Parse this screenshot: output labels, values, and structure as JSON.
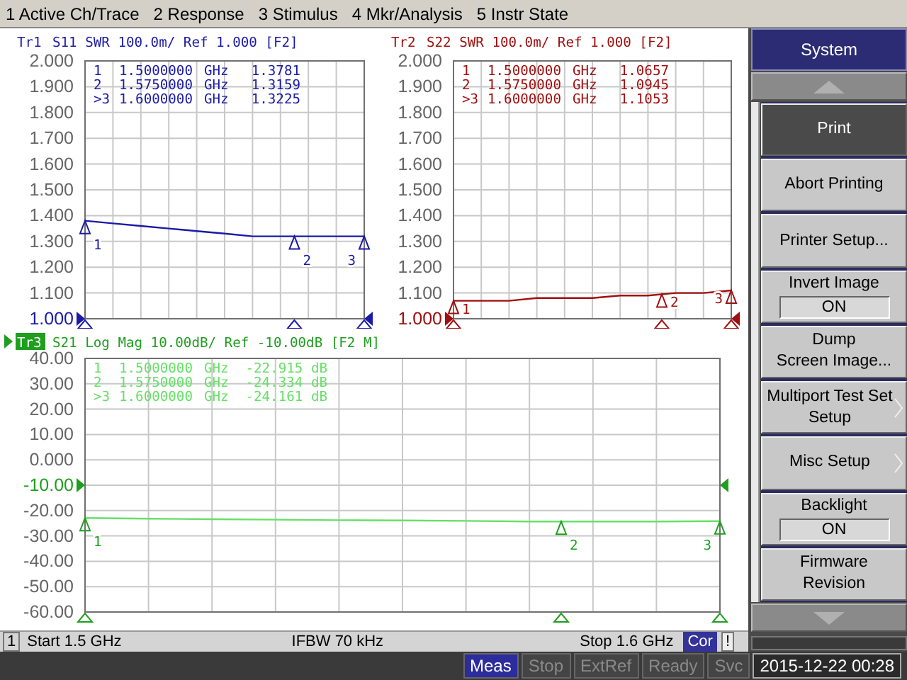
{
  "menu": [
    "1 Active Ch/Trace",
    "2 Response",
    "3 Stimulus",
    "4 Mkr/Analysis",
    "5 Instr State"
  ],
  "traces": [
    {
      "trace": "Tr1",
      "active": false,
      "header": "S11 SWR 100.0m/ Ref 1.000 [F2]",
      "markers": [
        {
          "number": "1",
          "frequency": "1.5000000",
          "unit": "GHz",
          "value": "1.3781",
          "label": "1"
        },
        {
          "number": "2",
          "frequency": "1.5750000",
          "unit": "GHz",
          "value": "1.3159",
          "label": "2"
        },
        {
          "number": ">3",
          "frequency": "1.6000000",
          "unit": "GHz",
          "value": "1.3225",
          "label": "3"
        }
      ],
      "chart_data": {
        "type": "line",
        "ylim": [
          1.0,
          2.0
        ],
        "yticks": [
          {
            "value": 2.0,
            "label": "2.000"
          },
          {
            "value": 1.9,
            "label": "1.900"
          },
          {
            "value": 1.8,
            "label": "1.800"
          },
          {
            "value": 1.7,
            "label": "1.700"
          },
          {
            "value": 1.6,
            "label": "1.600"
          },
          {
            "value": 1.5,
            "label": "1.500"
          },
          {
            "value": 1.4,
            "label": "1.400"
          },
          {
            "value": 1.3,
            "label": "1.300"
          },
          {
            "value": 1.2,
            "label": "1.200"
          },
          {
            "value": 1.1,
            "label": "1.100"
          },
          {
            "value": 1.0,
            "label": "1.000"
          }
        ],
        "categories": [
          null,
          null,
          null,
          null,
          null,
          null,
          null,
          null,
          null,
          null,
          null
        ],
        "grid": true,
        "series": [
          {
            "color": "#1a1aa6",
            "values": [
              1.38,
              1.37,
              1.36,
              1.35,
              1.34,
              1.33,
              1.32,
              1.32,
              1.32,
              1.32,
              1.32
            ]
          }
        ]
      }
    },
    {
      "trace": "Tr2",
      "active": false,
      "header": "S22 SWR 100.0m/ Ref 1.000 [F2]",
      "markers": [
        {
          "number": "1",
          "frequency": "1.5000000",
          "unit": "GHz",
          "value": "1.0657",
          "label": "1"
        },
        {
          "number": "2",
          "frequency": "1.5750000",
          "unit": "GHz",
          "value": "1.0945",
          "label": "2"
        },
        {
          "number": ">3",
          "frequency": "1.6000000",
          "unit": "GHz",
          "value": "1.1053",
          "label": "3"
        }
      ],
      "chart_data": {
        "type": "line",
        "ylim": [
          1.0,
          2.0
        ],
        "yticks": [
          {
            "value": 2.0,
            "label": "2.000"
          },
          {
            "value": 1.9,
            "label": "1.900"
          },
          {
            "value": 1.8,
            "label": "1.800"
          },
          {
            "value": 1.7,
            "label": "1.700"
          },
          {
            "value": 1.6,
            "label": "1.600"
          },
          {
            "value": 1.5,
            "label": "1.500"
          },
          {
            "value": 1.4,
            "label": "1.400"
          },
          {
            "value": 1.3,
            "label": "1.300"
          },
          {
            "value": 1.2,
            "label": "1.200"
          },
          {
            "value": 1.1,
            "label": "1.100"
          },
          {
            "value": 1.0,
            "label": "1.000"
          }
        ],
        "categories": [
          null,
          null,
          null,
          null,
          null,
          null,
          null,
          null,
          null,
          null,
          null
        ],
        "grid": true,
        "series": [
          {
            "color": "#a01010",
            "values": [
              1.07,
              1.07,
              1.07,
              1.08,
              1.08,
              1.08,
              1.09,
              1.09,
              1.1,
              1.1,
              1.11
            ]
          }
        ]
      }
    },
    {
      "trace": "Tr3",
      "active": true,
      "header": "S21 Log Mag 10.00dB/ Ref -10.00dB [F2 M]",
      "markers": [
        {
          "number": "1",
          "frequency": "1.5000000",
          "unit": "GHz",
          "value": "-22.915 dB",
          "label": "1"
        },
        {
          "number": "2",
          "frequency": "1.5750000",
          "unit": "GHz",
          "value": "-24.334 dB",
          "label": "2"
        },
        {
          "number": ">3",
          "frequency": "1.6000000",
          "unit": "GHz",
          "value": "-24.161 dB",
          "label": "3"
        }
      ],
      "chart_data": {
        "type": "line",
        "ylim": [
          -60,
          40
        ],
        "yticks": [
          {
            "value": 40,
            "label": "40.00"
          },
          {
            "value": 30,
            "label": "30.00"
          },
          {
            "value": 20,
            "label": "20.00"
          },
          {
            "value": 10,
            "label": "10.00"
          },
          {
            "value": 0,
            "label": "0.000"
          },
          {
            "value": -10,
            "label": "-10.00"
          },
          {
            "value": -20,
            "label": "-20.00"
          },
          {
            "value": -30,
            "label": "-30.00"
          },
          {
            "value": -40,
            "label": "-40.00"
          },
          {
            "value": -50,
            "label": "-50.00"
          },
          {
            "value": -60,
            "label": "-60.00"
          }
        ],
        "categories": [
          null,
          null,
          null,
          null,
          null,
          null,
          null,
          null,
          null,
          null,
          null
        ],
        "grid": true,
        "series": [
          {
            "color": "#66e066",
            "values": [
              -22.9,
              -23.2,
              -23.4,
              -23.6,
              -23.8,
              -23.9,
              -24.1,
              -24.3,
              -24.3,
              -24.3,
              -24.2
            ]
          }
        ]
      }
    }
  ],
  "channel_status": {
    "channel": "1",
    "start": "Start 1.5 GHz",
    "ifbw": "IFBW 70 kHz",
    "stop": "Stop 1.6 GHz",
    "correction": "Cor",
    "warning": "!"
  },
  "softkeys": {
    "title": "System",
    "items": [
      {
        "kind": "button",
        "lines": [
          "Print"
        ],
        "selected": true
      },
      {
        "kind": "button",
        "lines": [
          "Abort Printing"
        ],
        "selected": false
      },
      {
        "kind": "button",
        "lines": [
          "Printer Setup..."
        ],
        "selected": false
      },
      {
        "kind": "toggle",
        "lines": [
          "Invert Image"
        ],
        "value": "ON",
        "selected": false
      },
      {
        "kind": "button",
        "lines": [
          "Dump",
          "Screen Image..."
        ],
        "selected": false
      },
      {
        "kind": "submenu",
        "lines": [
          "Multiport Test Set",
          "Setup"
        ],
        "selected": false
      },
      {
        "kind": "submenu",
        "lines": [
          "Misc Setup"
        ],
        "selected": false
      },
      {
        "kind": "toggle",
        "lines": [
          "Backlight"
        ],
        "value": "ON",
        "selected": false
      },
      {
        "kind": "button",
        "lines": [
          "Firmware",
          "Revision"
        ],
        "selected": false
      }
    ]
  },
  "indicators": [
    {
      "label": "Meas",
      "active": true
    },
    {
      "label": "Stop",
      "active": false
    },
    {
      "label": "ExtRef",
      "active": false
    },
    {
      "label": "Ready",
      "active": false
    },
    {
      "label": "Svc",
      "active": false
    }
  ],
  "clock": "2015-12-22 00:28"
}
